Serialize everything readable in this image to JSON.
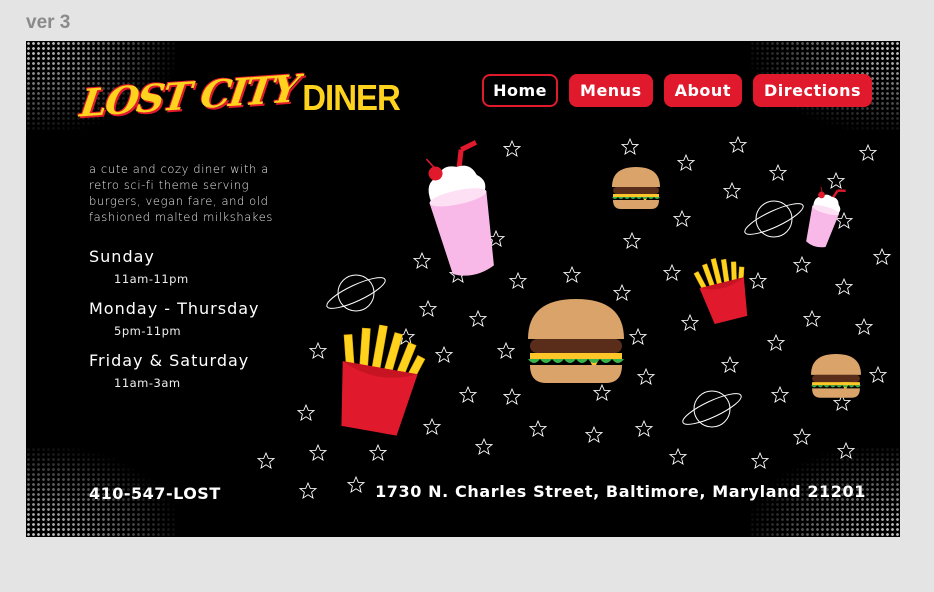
{
  "version_label": "ver 3",
  "logo": {
    "word1": "LOST CITY",
    "word2": "DINER"
  },
  "nav": [
    {
      "label": "Home",
      "active": true
    },
    {
      "label": "Menus",
      "active": false
    },
    {
      "label": "About",
      "active": false
    },
    {
      "label": "Directions",
      "active": false
    }
  ],
  "tagline": "a cute and cozy diner with a retro sci-fi theme serving burgers, vegan fare, and old fashioned malted milkshakes",
  "hours": [
    {
      "day": "Sunday",
      "time": "11am-11pm"
    },
    {
      "day": "Monday - Thursday",
      "time": "5pm-11pm"
    },
    {
      "day": "Friday & Saturday",
      "time": "11am-3am"
    }
  ],
  "phone": "410-547-LOST",
  "address": "1730 N. Charles Street, Baltimore, Maryland 21201",
  "colors": {
    "accent": "#e01a2c",
    "logo": "#ffd21e",
    "background": "#000000",
    "page": "#e4e4e4"
  },
  "illustrations": [
    "milkshake-icon",
    "burger-icon",
    "fries-icon",
    "planet-icon",
    "star-icon"
  ]
}
